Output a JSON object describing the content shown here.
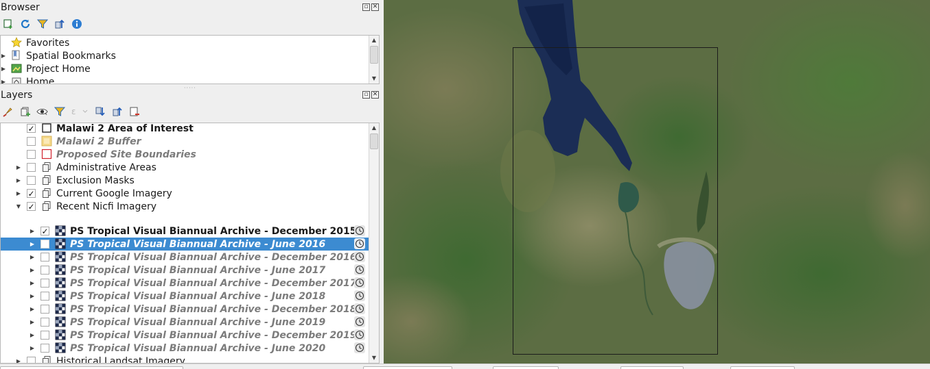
{
  "browser": {
    "title": "Browser",
    "float_glyph": "▫",
    "close_glyph": "✕",
    "items": [
      {
        "label": "Favorites",
        "icon": "star-icon"
      },
      {
        "label": "Spatial Bookmarks",
        "icon": "bookmark-icon"
      },
      {
        "label": "Project Home",
        "icon": "project-home-icon"
      },
      {
        "label": "Home",
        "icon": "home-folder-icon"
      }
    ]
  },
  "layers": {
    "title": "Layers",
    "float_glyph": "▫",
    "close_glyph": "✕",
    "items": [
      {
        "label": "Malawi 2 Area of Interest",
        "checked": "✓",
        "style": "bold",
        "icon": "polygon-layer-icon"
      },
      {
        "label": "Malawi 2 Buffer",
        "checked": "",
        "style": "italic",
        "icon": "buffer-symbol-icon"
      },
      {
        "label": "Proposed Site Boundaries",
        "checked": "",
        "style": "italic",
        "icon": "outline-symbol-icon"
      },
      {
        "label": "Administrative Areas",
        "checked": "",
        "style": "normal",
        "icon": "group-icon"
      },
      {
        "label": "Exclusion Masks",
        "checked": "",
        "style": "normal",
        "icon": "group-icon"
      },
      {
        "label": "Current Google Imagery",
        "checked": "✓",
        "style": "normal",
        "icon": "group-icon"
      },
      {
        "label": "Recent Nicfi Imagery",
        "checked": "✓",
        "style": "normal",
        "icon": "group-icon"
      },
      {
        "label": "PS Tropical Visual Biannual Archive - December 2015",
        "checked": "✓",
        "style": "bold",
        "icon": "raster-icon"
      },
      {
        "label": "PS Tropical Visual Biannual Archive - June 2016",
        "checked": "",
        "style": "italic",
        "icon": "raster-icon"
      },
      {
        "label": "PS Tropical Visual Biannual Archive - December 2016",
        "checked": "",
        "style": "italic",
        "icon": "raster-icon"
      },
      {
        "label": "PS Tropical Visual Biannual Archive - June 2017",
        "checked": "",
        "style": "italic",
        "icon": "raster-icon"
      },
      {
        "label": "PS Tropical Visual Biannual Archive - December 2017",
        "checked": "",
        "style": "italic",
        "icon": "raster-icon"
      },
      {
        "label": "PS Tropical Visual Biannual Archive - June 2018",
        "checked": "",
        "style": "italic",
        "icon": "raster-icon"
      },
      {
        "label": "PS Tropical Visual Biannual Archive - December 2018",
        "checked": "",
        "style": "italic",
        "icon": "raster-icon"
      },
      {
        "label": "PS Tropical Visual Biannual Archive - June 2019",
        "checked": "",
        "style": "italic",
        "icon": "raster-icon"
      },
      {
        "label": "PS Tropical Visual Biannual Archive - December 2019",
        "checked": "",
        "style": "italic",
        "icon": "raster-icon"
      },
      {
        "label": "PS Tropical Visual Biannual Archive - June 2020",
        "checked": "",
        "style": "italic",
        "icon": "raster-icon"
      },
      {
        "label": "Historical Landsat Imagery",
        "checked": "",
        "style": "normal",
        "icon": "group-icon"
      }
    ]
  },
  "colors": {
    "selection": "#3c8bd1",
    "map_base": "#5d6f44",
    "lake": "#1b2d55"
  }
}
